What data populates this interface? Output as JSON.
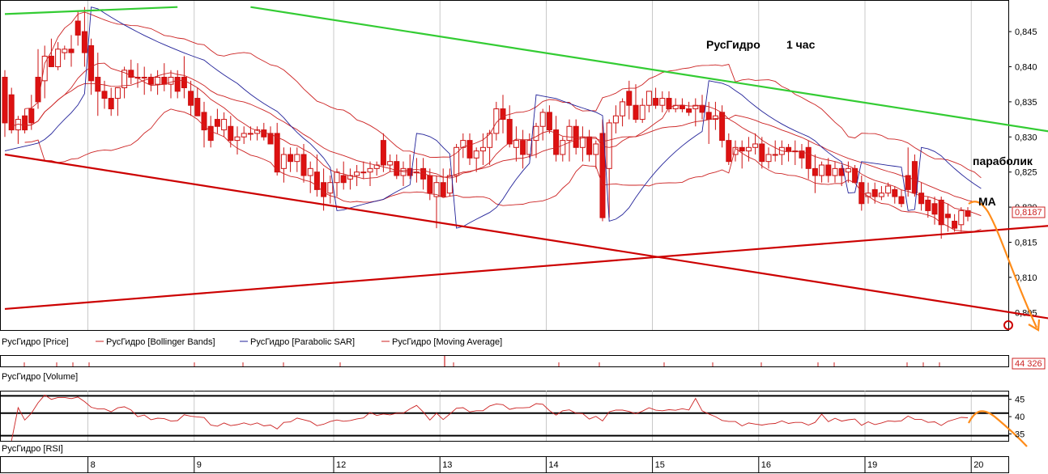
{
  "chart_data": {
    "type": "candlestick",
    "title": "РусГидро",
    "subtitle": "1 час",
    "price_panel": {
      "ylim": [
        0.8025,
        0.8495
      ],
      "yticks": [
        0.845,
        0.84,
        0.835,
        0.83,
        0.825,
        0.82,
        0.815,
        0.81,
        0.805
      ],
      "ytick_labels": [
        "0,845",
        "0,840",
        "0,835",
        "0,830",
        "0,825",
        "0,820",
        "0,815",
        "0,810",
        "0,805"
      ],
      "last_price": 0.8187,
      "last_price_label": "0,8187",
      "candles": [
        [
          0.8385,
          0.8395,
          0.83,
          0.832
        ],
        [
          0.836,
          0.837,
          0.8305,
          0.831
        ],
        [
          0.831,
          0.833,
          0.829,
          0.8325
        ],
        [
          0.833,
          0.834,
          0.8305,
          0.831
        ],
        [
          0.834,
          0.836,
          0.831,
          0.832
        ],
        [
          0.8385,
          0.8425,
          0.834,
          0.835
        ],
        [
          0.838,
          0.843,
          0.8355,
          0.8415
        ],
        [
          0.8415,
          0.844,
          0.84,
          0.84
        ],
        [
          0.84,
          0.8435,
          0.8395,
          0.8425
        ],
        [
          0.842,
          0.843,
          0.841,
          0.8425
        ],
        [
          0.8425,
          0.8445,
          0.84,
          0.842
        ],
        [
          0.8465,
          0.848,
          0.843,
          0.8445
        ],
        [
          0.845,
          0.8485,
          0.84,
          0.842
        ],
        [
          0.843,
          0.844,
          0.836,
          0.838
        ],
        [
          0.8385,
          0.842,
          0.833,
          0.8365
        ],
        [
          0.8365,
          0.838,
          0.834,
          0.8355
        ],
        [
          0.8355,
          0.837,
          0.833,
          0.834
        ],
        [
          0.8355,
          0.837,
          0.833,
          0.837
        ],
        [
          0.837,
          0.84,
          0.8355,
          0.8395
        ],
        [
          0.8395,
          0.841,
          0.8375,
          0.8385
        ],
        [
          0.8385,
          0.8405,
          0.837,
          0.8385
        ],
        [
          0.8385,
          0.84,
          0.836,
          0.8385
        ],
        [
          0.8385,
          0.839,
          0.8365,
          0.8375
        ],
        [
          0.8375,
          0.8395,
          0.836,
          0.8385
        ],
        [
          0.8385,
          0.8405,
          0.8365,
          0.8375
        ],
        [
          0.8375,
          0.8395,
          0.8355,
          0.8385
        ],
        [
          0.8385,
          0.8395,
          0.8355,
          0.8365
        ],
        [
          0.8385,
          0.8415,
          0.8355,
          0.837
        ],
        [
          0.8365,
          0.838,
          0.833,
          0.8345
        ],
        [
          0.8355,
          0.837,
          0.833,
          0.833
        ],
        [
          0.8335,
          0.835,
          0.8285,
          0.831
        ],
        [
          0.8315,
          0.833,
          0.8285,
          0.8295
        ],
        [
          0.8325,
          0.834,
          0.8305,
          0.8315
        ],
        [
          0.831,
          0.8335,
          0.83,
          0.8325
        ],
        [
          0.8315,
          0.833,
          0.8285,
          0.8295
        ],
        [
          0.8295,
          0.8315,
          0.8275,
          0.83
        ],
        [
          0.83,
          0.8315,
          0.829,
          0.8305
        ],
        [
          0.8305,
          0.8315,
          0.8295,
          0.8305
        ],
        [
          0.8305,
          0.8315,
          0.8295,
          0.831
        ],
        [
          0.831,
          0.832,
          0.8295,
          0.83
        ],
        [
          0.8305,
          0.8315,
          0.829,
          0.829
        ],
        [
          0.8305,
          0.832,
          0.8245,
          0.825
        ],
        [
          0.8255,
          0.8285,
          0.8235,
          0.8275
        ],
        [
          0.8275,
          0.8285,
          0.825,
          0.8265
        ],
        [
          0.8265,
          0.8285,
          0.825,
          0.8275
        ],
        [
          0.8275,
          0.829,
          0.8235,
          0.8245
        ],
        [
          0.8245,
          0.8265,
          0.822,
          0.8255
        ],
        [
          0.825,
          0.8275,
          0.8215,
          0.8225
        ],
        [
          0.8235,
          0.8255,
          0.8195,
          0.8215
        ],
        [
          0.822,
          0.8245,
          0.8205,
          0.8235
        ],
        [
          0.8235,
          0.8255,
          0.8215,
          0.825
        ],
        [
          0.8245,
          0.8265,
          0.8225,
          0.8235
        ],
        [
          0.824,
          0.8255,
          0.8225,
          0.8245
        ],
        [
          0.8245,
          0.826,
          0.823,
          0.825
        ],
        [
          0.825,
          0.8265,
          0.824,
          0.825
        ],
        [
          0.825,
          0.8265,
          0.823,
          0.8255
        ],
        [
          0.8255,
          0.8265,
          0.8245,
          0.826
        ],
        [
          0.8295,
          0.8305,
          0.825,
          0.826
        ],
        [
          0.826,
          0.8275,
          0.825,
          0.8265
        ],
        [
          0.8265,
          0.8275,
          0.824,
          0.8245
        ],
        [
          0.8245,
          0.8265,
          0.823,
          0.8255
        ],
        [
          0.8255,
          0.8275,
          0.824,
          0.8245
        ],
        [
          0.825,
          0.827,
          0.8235,
          0.825
        ],
        [
          0.8255,
          0.827,
          0.8225,
          0.824
        ],
        [
          0.8245,
          0.8255,
          0.821,
          0.822
        ],
        [
          0.8215,
          0.8245,
          0.817,
          0.8235
        ],
        [
          0.8235,
          0.8255,
          0.8215,
          0.8215
        ],
        [
          0.822,
          0.8255,
          0.8215,
          0.8245
        ],
        [
          0.8245,
          0.829,
          0.8235,
          0.8285
        ],
        [
          0.8285,
          0.8305,
          0.827,
          0.8295
        ],
        [
          0.8295,
          0.8305,
          0.826,
          0.827
        ],
        [
          0.827,
          0.8285,
          0.825,
          0.828
        ],
        [
          0.828,
          0.8305,
          0.826,
          0.8285
        ],
        [
          0.8285,
          0.831,
          0.826,
          0.8305
        ],
        [
          0.8305,
          0.835,
          0.8295,
          0.834
        ],
        [
          0.834,
          0.836,
          0.8305,
          0.8325
        ],
        [
          0.8325,
          0.8345,
          0.8285,
          0.829
        ],
        [
          0.8285,
          0.8315,
          0.8265,
          0.8295
        ],
        [
          0.8295,
          0.831,
          0.8255,
          0.8275
        ],
        [
          0.8275,
          0.8305,
          0.827,
          0.8295
        ],
        [
          0.8295,
          0.832,
          0.827,
          0.8315
        ],
        [
          0.8315,
          0.834,
          0.8295,
          0.8335
        ],
        [
          0.8335,
          0.8345,
          0.8305,
          0.831
        ],
        [
          0.831,
          0.833,
          0.8265,
          0.8275
        ],
        [
          0.8275,
          0.83,
          0.8265,
          0.8295
        ],
        [
          0.8295,
          0.8325,
          0.8265,
          0.8315
        ],
        [
          0.8315,
          0.8325,
          0.8275,
          0.8285
        ],
        [
          0.8285,
          0.8315,
          0.8265,
          0.83
        ],
        [
          0.83,
          0.831,
          0.8265,
          0.8275
        ],
        [
          0.8275,
          0.8295,
          0.8255,
          0.829
        ],
        [
          0.8305,
          0.8325,
          0.818,
          0.8185
        ],
        [
          0.8255,
          0.8325,
          0.8185,
          0.832
        ],
        [
          0.832,
          0.8345,
          0.8305,
          0.833
        ],
        [
          0.833,
          0.8355,
          0.8315,
          0.835
        ],
        [
          0.8365,
          0.838,
          0.8325,
          0.8345
        ],
        [
          0.8345,
          0.8375,
          0.832,
          0.8325
        ],
        [
          0.8325,
          0.8355,
          0.832,
          0.8345
        ],
        [
          0.8345,
          0.8365,
          0.8335,
          0.8365
        ],
        [
          0.8355,
          0.837,
          0.834,
          0.8345
        ],
        [
          0.8345,
          0.8365,
          0.8335,
          0.8355
        ],
        [
          0.8355,
          0.8365,
          0.8335,
          0.834
        ],
        [
          0.834,
          0.8355,
          0.8335,
          0.8345
        ],
        [
          0.8345,
          0.8355,
          0.8335,
          0.834
        ],
        [
          0.834,
          0.835,
          0.833,
          0.8335
        ],
        [
          0.834,
          0.8355,
          0.8315,
          0.8345
        ],
        [
          0.8345,
          0.836,
          0.8325,
          0.8335
        ],
        [
          0.8335,
          0.835,
          0.829,
          0.8325
        ],
        [
          0.8325,
          0.835,
          0.831,
          0.833
        ],
        [
          0.8335,
          0.8345,
          0.8285,
          0.8295
        ],
        [
          0.8295,
          0.8305,
          0.826,
          0.8265
        ],
        [
          0.8275,
          0.8295,
          0.8265,
          0.8285
        ],
        [
          0.8285,
          0.8295,
          0.8255,
          0.828
        ],
        [
          0.828,
          0.83,
          0.8265,
          0.8285
        ],
        [
          0.8285,
          0.8305,
          0.8275,
          0.829
        ],
        [
          0.829,
          0.83,
          0.8255,
          0.8265
        ],
        [
          0.8265,
          0.8285,
          0.8255,
          0.8275
        ],
        [
          0.8275,
          0.8295,
          0.8265,
          0.8275
        ],
        [
          0.8275,
          0.8295,
          0.826,
          0.8285
        ],
        [
          0.8285,
          0.829,
          0.8265,
          0.828
        ],
        [
          0.828,
          0.8295,
          0.826,
          0.828
        ],
        [
          0.828,
          0.829,
          0.8255,
          0.827
        ],
        [
          0.8285,
          0.8295,
          0.824,
          0.8255
        ],
        [
          0.8255,
          0.8275,
          0.822,
          0.8245
        ],
        [
          0.8245,
          0.8265,
          0.8235,
          0.826
        ],
        [
          0.826,
          0.827,
          0.8235,
          0.8245
        ],
        [
          0.8245,
          0.8265,
          0.8235,
          0.8255
        ],
        [
          0.8255,
          0.826,
          0.823,
          0.8245
        ],
        [
          0.825,
          0.8265,
          0.8235,
          0.8255
        ],
        [
          0.8255,
          0.826,
          0.8235,
          0.8235
        ],
        [
          0.8235,
          0.8245,
          0.8195,
          0.8205
        ],
        [
          0.8215,
          0.8235,
          0.8205,
          0.822
        ],
        [
          0.8225,
          0.8235,
          0.8205,
          0.8215
        ],
        [
          0.8215,
          0.823,
          0.821,
          0.822
        ],
        [
          0.822,
          0.8235,
          0.8215,
          0.823
        ],
        [
          0.8225,
          0.823,
          0.8205,
          0.8215
        ],
        [
          0.8215,
          0.8225,
          0.82,
          0.8205
        ],
        [
          0.8245,
          0.8285,
          0.8215,
          0.8225
        ],
        [
          0.8265,
          0.8275,
          0.8215,
          0.822
        ],
        [
          0.822,
          0.8235,
          0.8195,
          0.8205
        ],
        [
          0.821,
          0.8215,
          0.8185,
          0.8195
        ],
        [
          0.8205,
          0.8215,
          0.8175,
          0.819
        ],
        [
          0.821,
          0.8215,
          0.8155,
          0.8175
        ],
        [
          0.819,
          0.8205,
          0.8165,
          0.8185
        ],
        [
          0.818,
          0.819,
          0.8165,
          0.817
        ],
        [
          0.8175,
          0.82,
          0.8165,
          0.8195
        ],
        [
          0.8195,
          0.82,
          0.818,
          0.8187
        ]
      ],
      "day_ticks": [
        "8",
        "9",
        "12",
        "13",
        "14",
        "15",
        "16",
        "19",
        "20"
      ],
      "day_index": [
        13,
        29,
        50,
        66,
        82,
        98,
        114,
        130,
        146
      ],
      "n": 148,
      "trendlines": [
        {
          "color": "#33cc33",
          "x": [
            0,
            26
          ],
          "y": [
            0.8475,
            0.8485
          ]
        },
        {
          "color": "#33cc33",
          "x": [
            37,
            166
          ],
          "y": [
            0.8485,
            0.8295
          ]
        },
        {
          "color": "#cc0000",
          "x": [
            0,
            165
          ],
          "y": [
            0.8275,
            0.803
          ]
        },
        {
          "color": "#cc0000",
          "x": [
            0,
            166
          ],
          "y": [
            0.8055,
            0.818
          ]
        }
      ],
      "legend": [
        "РусГидро [Price]",
        "РусГидро [Bollinger Bands]",
        "РусГидро [Parabolic SAR]",
        "РусГидро [Moving Average]"
      ],
      "annotations": [
        "парaболик",
        "MA"
      ]
    },
    "volume_panel": {
      "label": "РусГидро [Volume]",
      "last_value_label": "44 326"
    },
    "rsi_panel": {
      "label": "РусГидро [RSI]",
      "ylim": [
        33,
        47.5
      ],
      "yticks": [
        45,
        40,
        35
      ],
      "ytick_labels": [
        "45",
        "40",
        "35"
      ],
      "levels": [
        46,
        41,
        34.5
      ]
    },
    "colors": {
      "up": "#ffffff",
      "down": "#dd1111",
      "wick": "#cc1111",
      "bollinger": "#cc2222",
      "sar": "#222299",
      "ma": "#cc2222",
      "forecast": "#ff8c1a",
      "green": "#33cc33",
      "grid": "#bbbbbb"
    }
  }
}
